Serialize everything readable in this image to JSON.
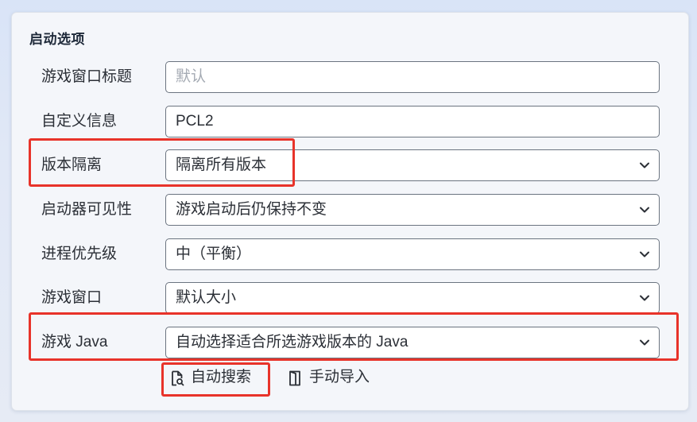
{
  "section": {
    "title": "启动选项"
  },
  "fields": {
    "window_title": {
      "label": "游戏窗口标题",
      "value": "",
      "placeholder": "默认"
    },
    "custom_info": {
      "label": "自定义信息",
      "value": "PCL2"
    },
    "version_isolation": {
      "label": "版本隔离",
      "selected": "隔离所有版本"
    },
    "launcher_visibility": {
      "label": "启动器可见性",
      "selected": "游戏启动后仍保持不变"
    },
    "process_priority": {
      "label": "进程优先级",
      "selected": "中（平衡）"
    },
    "game_window": {
      "label": "游戏窗口",
      "selected": "默认大小"
    },
    "game_java": {
      "label": "游戏 Java",
      "selected": "自动选择适合所选游戏版本的 Java"
    }
  },
  "actions": {
    "auto_search": {
      "label": "自动搜索",
      "icon": "file-search-icon"
    },
    "manual_import": {
      "label": "手动导入",
      "icon": "door-import-icon"
    }
  },
  "colors": {
    "highlight": "#e8332a",
    "field_border": "#6b7480",
    "card_background": "#f4f6fa"
  }
}
